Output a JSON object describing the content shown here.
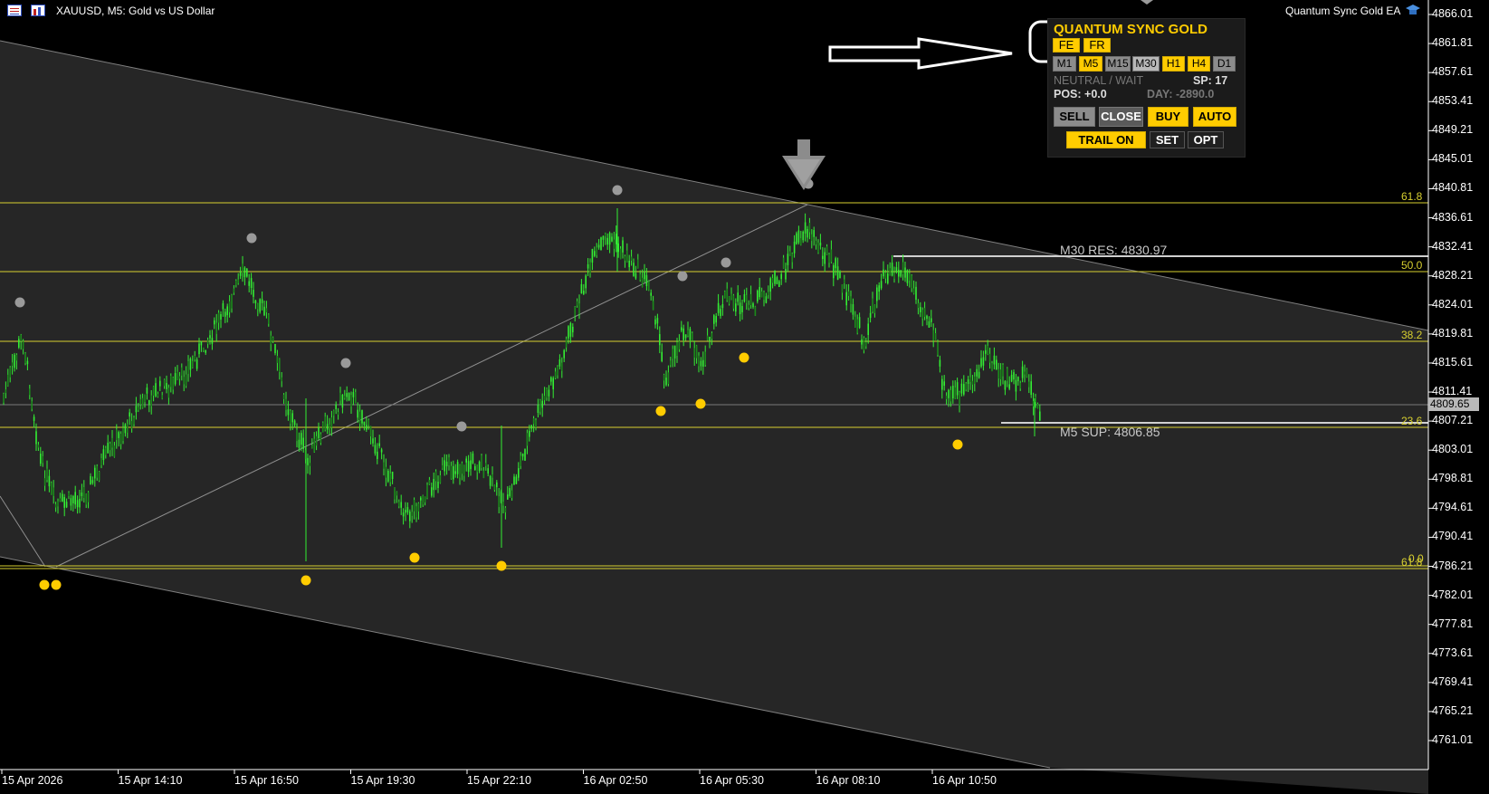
{
  "window": {
    "symbol_title": "XAUUSD, M5:  Gold vs US Dollar",
    "ea_name": "Quantum Sync Gold EA"
  },
  "price_axis": [
    "4866.01",
    "4861.81",
    "4857.61",
    "4853.41",
    "4849.21",
    "4845.01",
    "4840.81",
    "4836.61",
    "4832.41",
    "4828.21",
    "4824.01",
    "4819.81",
    "4815.61",
    "4811.41",
    "4807.21",
    "4803.01",
    "4798.81",
    "4794.61",
    "4790.41",
    "4786.21",
    "4782.01",
    "4777.81",
    "4773.61",
    "4769.41",
    "4765.21",
    "4761.01"
  ],
  "time_axis": [
    "15 Apr 2026",
    "15 Apr 14:10",
    "15 Apr 16:50",
    "15 Apr 19:30",
    "15 Apr 22:10",
    "16 Apr 02:50",
    "16 Apr 05:30",
    "16 Apr 08:10",
    "16 Apr 10:50"
  ],
  "current_price": "4809.65",
  "fib_labels": {
    "f618_top": "61.8",
    "f500": "50.0",
    "f382": "38.2",
    "f236": "23.6",
    "f00": "0.0",
    "f618_bottom": "61.8"
  },
  "levels": {
    "resistance": "M30 RES: 4830.97",
    "support": "M5 SUP: 4806.85"
  },
  "ea_panel": {
    "title": "QUANTUM SYNC GOLD",
    "mode_buttons": [
      "FE",
      "FR"
    ],
    "timeframes": [
      "M1",
      "M5",
      "M15",
      "M30",
      "H1",
      "H4",
      "D1"
    ],
    "status": "NEUTRAL / WAIT",
    "spread": "SP: 17",
    "position": "POS: +0.0",
    "day": "DAY: -2890.0",
    "buttons": {
      "sell": "SELL",
      "close": "CLOSE",
      "buy": "BUY",
      "auto": "AUTO",
      "trail": "TRAIL ON",
      "set": "SET",
      "opt": "OPT"
    }
  },
  "colors": {
    "candle": "#33ee33",
    "fib_line": "#d8d030",
    "yellow_dot": "#ffcc00",
    "gray_dot": "#9a9a9a",
    "panel_accent": "#ffcc00",
    "channel_fill": "#262626"
  },
  "icons": [
    "chart-window-icon",
    "chart-bars-icon",
    "ea-hat-icon",
    "down-arrow-icon",
    "annotation-arrow-icon"
  ]
}
